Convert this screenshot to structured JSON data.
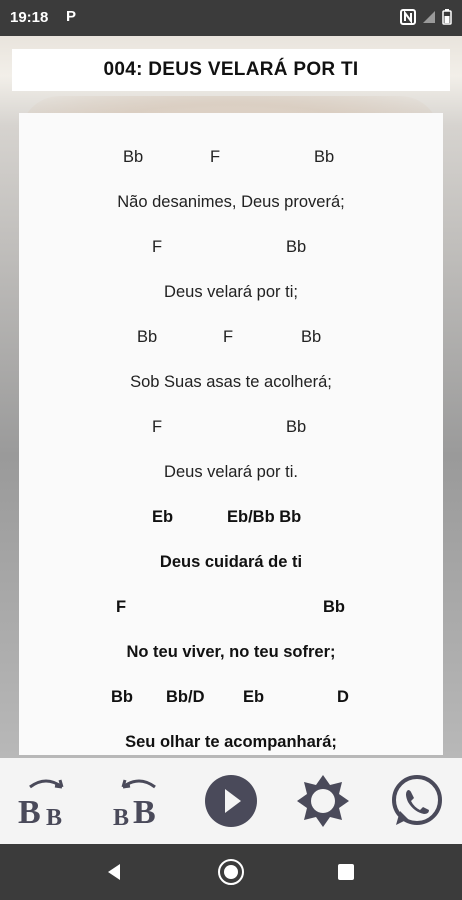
{
  "status": {
    "time": "19:18",
    "notification_letter": "P"
  },
  "title": "004: DEUS VELARÁ POR TI",
  "lyrics": {
    "c1": [
      "Bb",
      "F",
      "Bb"
    ],
    "l1": "Não desanimes, Deus proverá;",
    "c2": [
      "F",
      "Bb"
    ],
    "l2": "Deus velará por ti;",
    "c3": [
      "Bb",
      "F",
      "Bb"
    ],
    "l3": "Sob Suas asas te acolherá;",
    "c4": [
      "F",
      "Bb"
    ],
    "l4": "Deus velará por ti.",
    "c5": [
      "Eb",
      "Eb/Bb Bb"
    ],
    "l5": "Deus cuidará de ti",
    "c6": [
      "F",
      "Bb"
    ],
    "l6": "No teu viver, no teu sofrer;",
    "c7": [
      "Bb",
      "Bb/D",
      "Eb",
      "D"
    ],
    "l7": "Seu olhar te acompanhará;"
  },
  "toolbar": {
    "transpose_down_label": "BB",
    "transpose_up_label": "BB",
    "icons": [
      "transpose-down-icon",
      "transpose-up-icon",
      "play-icon",
      "brightness-icon",
      "whatsapp-icon"
    ],
    "icon_color": "#4a4a5a"
  }
}
